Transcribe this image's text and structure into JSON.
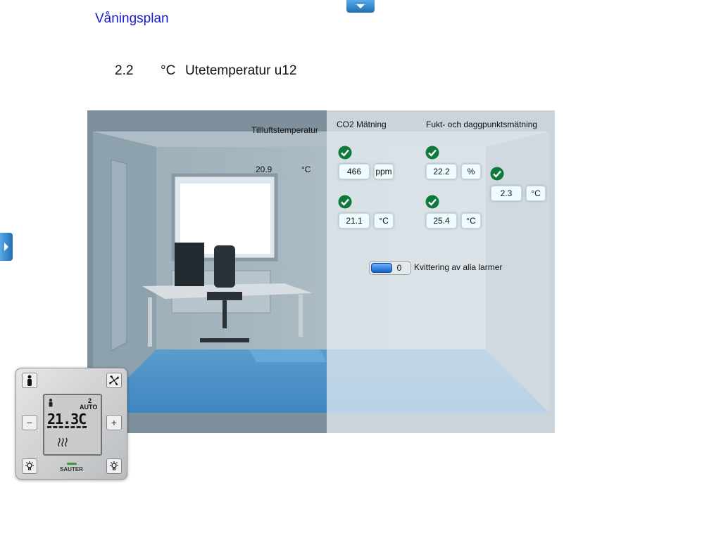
{
  "header": {
    "floorplan_link": "Våningsplan"
  },
  "outside_temperature": {
    "value": "2.2",
    "unit": "°C",
    "label": "Utetemperatur u12"
  },
  "sensors": {
    "supply_air": {
      "label": "Tillluftstemperatur",
      "value": "20.9",
      "unit": "°C"
    },
    "co2": {
      "label": "CO2 Mätning",
      "value": "466",
      "unit": "ppm"
    },
    "room_temp": {
      "value": "21.1",
      "unit": "°C"
    },
    "humidity": {
      "label": "Fukt- och daggpunktsmätning",
      "value": "22.2",
      "unit": "%"
    },
    "dewpoint": {
      "value": "25.4",
      "unit": "°C"
    },
    "extra": {
      "value": "2.3",
      "unit": "°C"
    }
  },
  "alarm_ack": {
    "count": "0",
    "label": "Kvittering av alla larmer"
  },
  "thermostat": {
    "display_setpoint": "2",
    "display_mode": "AUTO",
    "display_temp": "21.3C",
    "brand": "SAUTER"
  },
  "colors": {
    "accent": "#1f6fb6",
    "ok": "#0f7a3b",
    "link": "#1a1acc"
  },
  "icons": [
    "chevron-down-icon",
    "chevron-right-icon",
    "check-icon",
    "person-icon",
    "fan-icon",
    "minus-icon",
    "plus-icon",
    "light-icon"
  ]
}
